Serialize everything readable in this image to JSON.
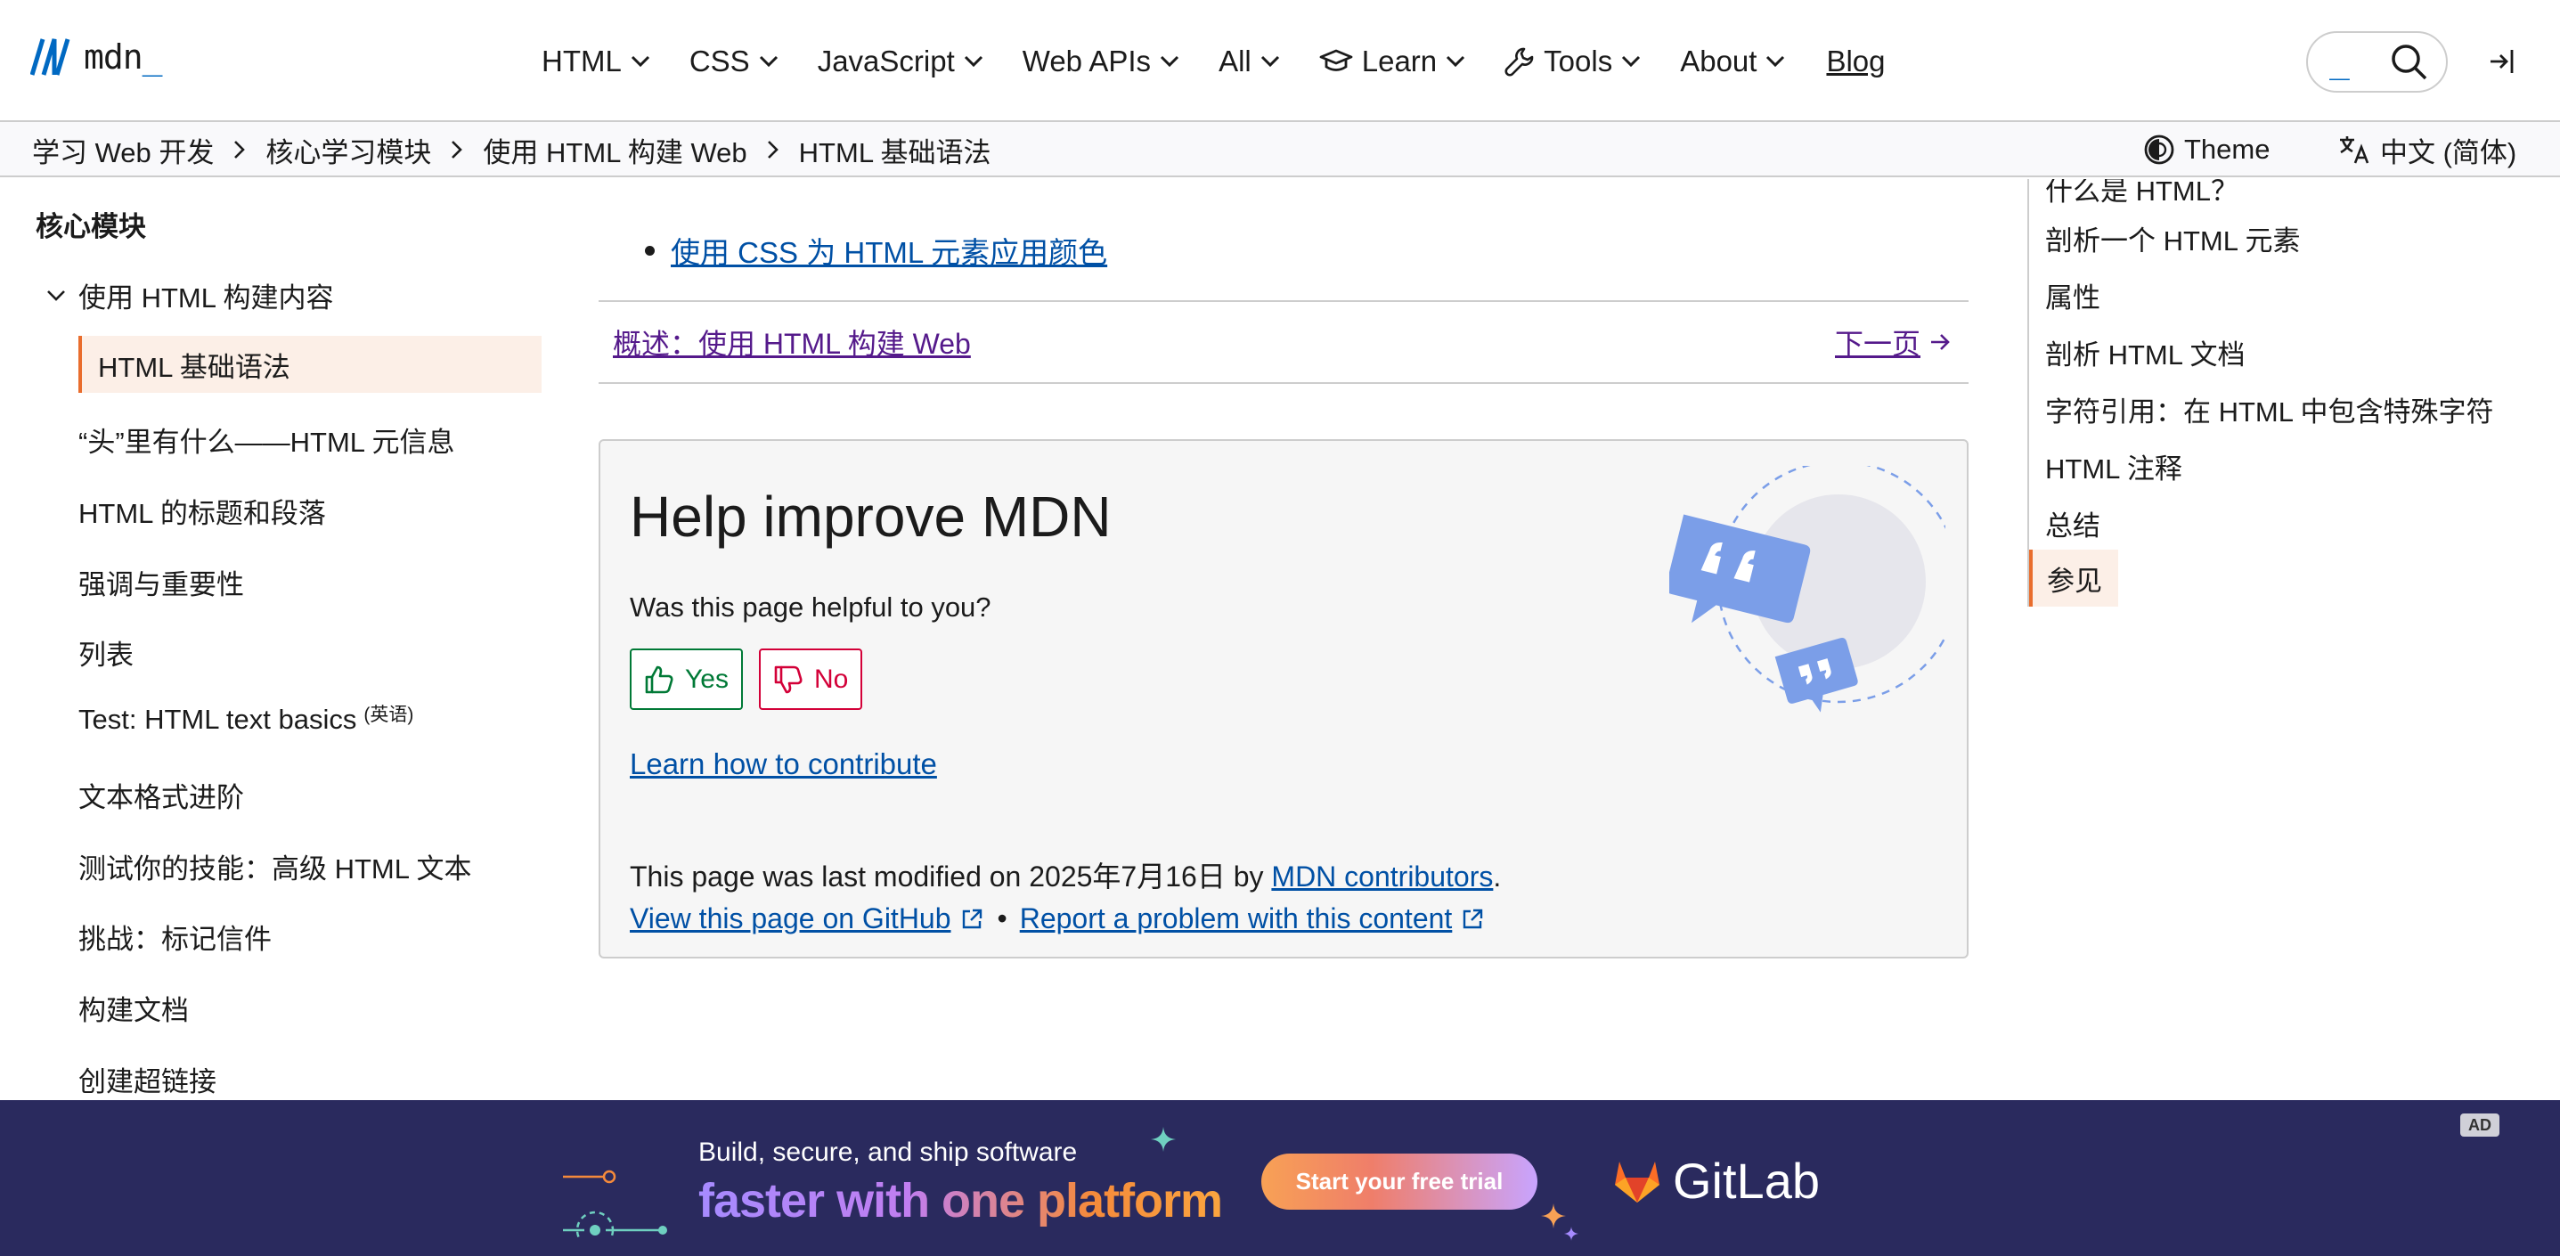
{
  "nav": {
    "logo_text": "mdn",
    "logo_cursor": "_",
    "menu": [
      {
        "label": "HTML"
      },
      {
        "label": "CSS"
      },
      {
        "label": "JavaScript"
      },
      {
        "label": "Web APIs"
      },
      {
        "label": "All"
      },
      {
        "label": "Learn",
        "icon": "graduation-cap-icon"
      },
      {
        "label": "Tools",
        "icon": "wrench-icon"
      },
      {
        "label": "About"
      }
    ],
    "blog_label": "Blog",
    "search_cursor": "_"
  },
  "breadcrumb": {
    "items": [
      "学习 Web 开发",
      "核心学习模块",
      "使用 HTML 构建 Web",
      "HTML 基础语法"
    ]
  },
  "toolbar": {
    "theme_label": "Theme",
    "lang_label": "中文 (简体)"
  },
  "sidebar": {
    "title": "核心模块",
    "section": "使用 HTML 构建内容",
    "items": [
      {
        "label": "HTML 基础语法",
        "active": true
      },
      {
        "label": "“头”里有什么——HTML 元信息"
      },
      {
        "label": "HTML 的标题和段落"
      },
      {
        "label": "强调与重要性"
      },
      {
        "label": "列表"
      },
      {
        "label": "Test: HTML text basics",
        "tag": "(英语)"
      },
      {
        "label": "文本格式进阶"
      },
      {
        "label": "测试你的技能：高级 HTML 文本"
      },
      {
        "label": "挑战：标记信件"
      },
      {
        "label": "构建文档"
      },
      {
        "label": "创建超链接"
      }
    ]
  },
  "main": {
    "list_link": "使用 CSS 为 HTML 元素应用颜色",
    "pager_prev": "概述：使用 HTML 构建 Web",
    "pager_next": "下一页",
    "feedback": {
      "title": "Help improve MDN",
      "question": "Was this page helpful to you?",
      "yes_label": "Yes",
      "no_label": "No",
      "contribute_link": "Learn how to contribute"
    },
    "modified_prefix": "This page was last modified on ",
    "modified_date": "2025年7月16日",
    "modified_by": " by ",
    "contributors_link": "MDN contributors",
    "modified_suffix": ".",
    "github_link": "View this page on GitHub",
    "bullet": "•",
    "report_link": "Report a problem with this content"
  },
  "toc": {
    "items": [
      {
        "label": "什么是 HTML？"
      },
      {
        "label": "剖析一个 HTML 元素"
      },
      {
        "label": "属性"
      },
      {
        "label": "剖析 HTML 文档"
      },
      {
        "label": "字符引用：在 HTML 中包含特殊字符"
      },
      {
        "label": "HTML 注释"
      },
      {
        "label": "总结"
      },
      {
        "label": "参见",
        "active": true
      }
    ]
  },
  "ad": {
    "line1": "Build, secure, and ship software",
    "line2": "faster with one platform",
    "cta": "Start your free trial",
    "brand": "GitLab",
    "badge": "AD"
  },
  "colors": {
    "accent_blue": "#0069c2",
    "link": "#0050a5",
    "visited": "#551a8b",
    "active_bg": "#fcefe7",
    "active_border": "#e96d2d",
    "yes": "#007936",
    "no": "#d30038",
    "ad_bg": "#2a2a5e"
  }
}
